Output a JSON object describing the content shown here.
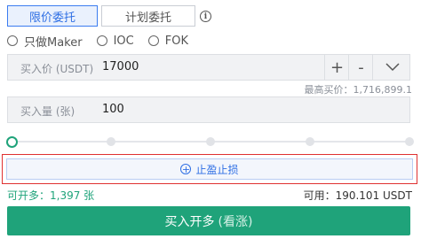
{
  "order_tabs": {
    "limit": "限价委托",
    "plan": "计划委托"
  },
  "icons": {
    "info": "info-circle-icon",
    "tpsl": "plus-circle-icon",
    "dropdown": "chevron-down-icon"
  },
  "radios": [
    {
      "label": "只做Maker",
      "selected": false
    },
    {
      "label": "IOC",
      "selected": false
    },
    {
      "label": "FOK",
      "selected": false
    }
  ],
  "price": {
    "label": "买入价 (USDT)",
    "value": "17000",
    "plus": "+",
    "minus": "-",
    "max_bid": "最高买价：1,716,899.1"
  },
  "amount": {
    "label": "买入量 (张)",
    "value": "100"
  },
  "slider": {
    "value_percent": 0,
    "stops": 5
  },
  "tpsl": {
    "label": "止盈止损"
  },
  "open_qty": "可开多：1,397 张",
  "available": "可用：190.101 USDT",
  "buy_button": {
    "label": "买入开多",
    "sub": "(看涨)"
  },
  "colors": {
    "accent_blue": "#2f6fe4",
    "buy_green": "#1fa37a",
    "highlight_red": "#e03131"
  }
}
